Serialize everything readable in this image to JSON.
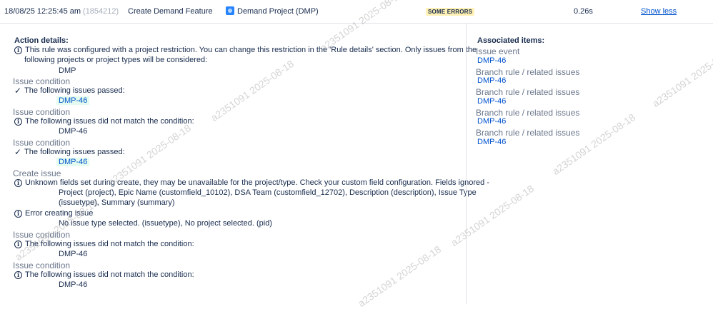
{
  "header": {
    "timestamp": "18/08/25 12:25:45 am",
    "run_id": "(1854212)",
    "rule_name": "Create Demand Feature",
    "project": "Demand Project (DMP)",
    "project_icon": "project-avatar-icon",
    "status": "SOME ERRORS",
    "status_color": "#fff0b3",
    "duration": "0.26s",
    "toggle_label": "Show less"
  },
  "action_details": {
    "title": "Action details:",
    "restriction_text_1": "This rule was configured with a project restriction. You can change this restriction in the 'Rule details' section. Only issues from the",
    "restriction_text_2": "following projects or project types will be considered:",
    "restriction_project": "DMP",
    "cond1_title": "Issue condition",
    "cond1_text": "The following issues passed:",
    "cond1_key": "DMP-46",
    "cond2_title": "Issue condition",
    "cond2_text": "The following issues did not match the condition:",
    "cond2_key": "DMP-46",
    "cond3_title": "Issue condition",
    "cond3_text": "The following issues passed:",
    "cond3_key": "DMP-46",
    "create_title": "Create issue",
    "create_warning_1": "Unknown fields set during create, they may be unavailable for the project/type. Check your custom field configuration. Fields ignored -",
    "create_warning_2": "Project (project), Epic Name (customfield_10102), DSA Team (customfield_12702), Description (description), Issue Type",
    "create_warning_3": "(issuetype), Summary (summary)",
    "error_text": "Error creating issue",
    "error_detail": "No issue type selected. (issuetype), No project selected. (pid)",
    "cond4_title": "Issue condition",
    "cond4_text": "The following issues did not match the condition:",
    "cond4_key": "DMP-46",
    "cond5_title": "Issue condition",
    "cond5_text": "The following issues did not match the condition:",
    "cond5_key": "DMP-46"
  },
  "associated": {
    "title": "Associated items:",
    "items": [
      {
        "label": "Issue event",
        "key": "DMP-46"
      },
      {
        "label": "Branch rule / related issues",
        "key": "DMP-46"
      },
      {
        "label": "Branch rule / related issues",
        "key": "DMP-46"
      },
      {
        "label": "Branch rule / related issues",
        "key": "DMP-46"
      },
      {
        "label": "Branch rule / related issues",
        "key": "DMP-46"
      }
    ]
  },
  "watermark": "a2351091 2025-08-18",
  "colors": {
    "link": "#0052cc",
    "muted": "#6b778c",
    "passed_bg": "#e3fcef"
  }
}
